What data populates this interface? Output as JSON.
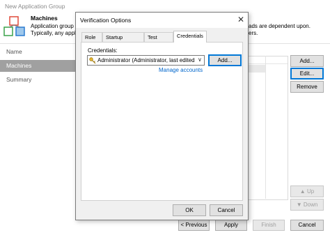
{
  "wizard": {
    "title": "New Application Group",
    "heading": "Machines",
    "description_line1": "Application group",
    "description_line2": "Typically, any applicati",
    "description_right_line1": "ads are dependent upon.",
    "description_right_line2": "ers.",
    "nav": [
      {
        "label": "Name"
      },
      {
        "label": "Machines"
      },
      {
        "label": "Summary"
      }
    ],
    "side_buttons": {
      "add": "Add...",
      "edit": "Edit...",
      "remove": "Remove",
      "up": "Up",
      "down": "Down"
    },
    "footer_buttons": {
      "previous": "< Previous",
      "apply": "Apply",
      "finish": "Finish",
      "cancel": "Cancel"
    }
  },
  "dialog": {
    "title": "Verification Options",
    "tabs": [
      {
        "label": "Role"
      },
      {
        "label": "Startup Options"
      },
      {
        "label": "Test Scripts"
      },
      {
        "label": "Credentials"
      }
    ],
    "active_tab": "Credentials",
    "credentials_label": "Credentials:",
    "credentials_value": "Administrator (Administrator, last edited",
    "add_button": "Add...",
    "manage_link": "Manage accounts",
    "ok_button": "OK",
    "cancel_button": "Cancel"
  },
  "icons": {
    "close": "close-icon",
    "dropdown": "chevron-down-icon",
    "key": "key-icon",
    "up": "arrow-up-icon",
    "down": "arrow-down-icon",
    "app_group": "app-group-icon"
  },
  "colors": {
    "accent": "#0078d7",
    "link": "#0066cc",
    "nav_selected": "#a0a0a0"
  }
}
